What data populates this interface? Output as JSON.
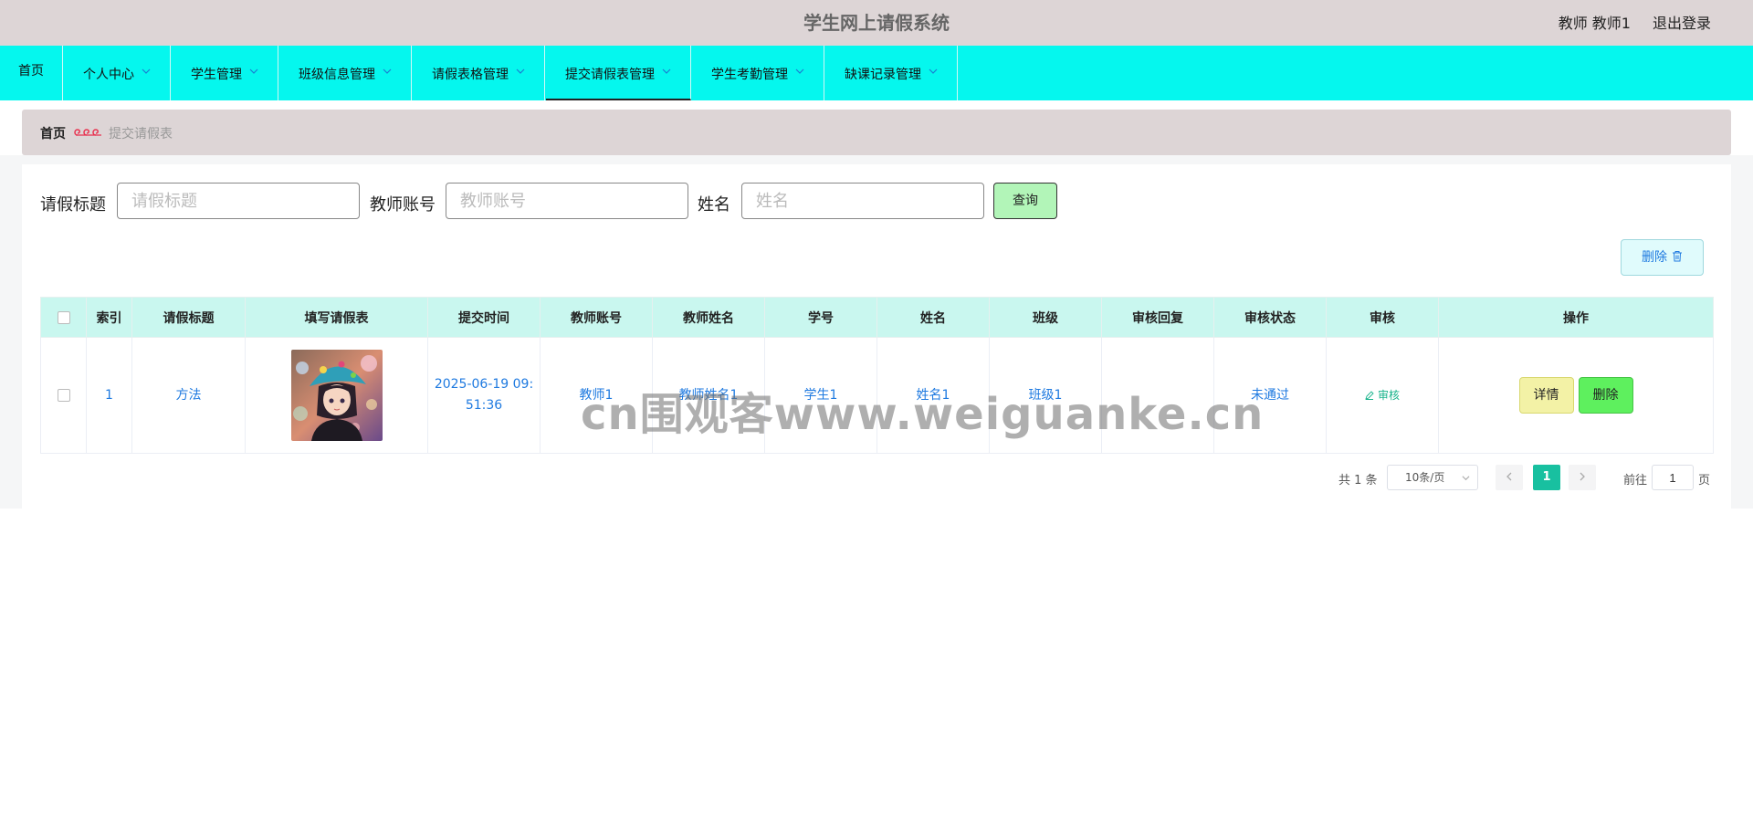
{
  "header": {
    "title": "学生网上请假系统",
    "user": "教师 教师1",
    "logout": "退出登录"
  },
  "nav": {
    "items": [
      {
        "label": "首页"
      },
      {
        "label": "个人中心"
      },
      {
        "label": "学生管理"
      },
      {
        "label": "班级信息管理"
      },
      {
        "label": "请假表格管理"
      },
      {
        "label": "提交请假表管理"
      },
      {
        "label": "学生考勤管理"
      },
      {
        "label": "缺课记录管理"
      }
    ],
    "active_index": 5
  },
  "breadcrumb": {
    "home": "首页",
    "current": "提交请假表"
  },
  "search": {
    "title_label": "请假标题",
    "title_placeholder": "请假标题",
    "teacher_label": "教师账号",
    "teacher_placeholder": "教师账号",
    "name_label": "姓名",
    "name_placeholder": "姓名",
    "query_button": "查询"
  },
  "toolbar": {
    "delete_label": "删除"
  },
  "table": {
    "headers": [
      "索引",
      "请假标题",
      "填写请假表",
      "提交时间",
      "教师账号",
      "教师姓名",
      "学号",
      "姓名",
      "班级",
      "审核回复",
      "审核状态",
      "审核",
      "操作"
    ],
    "rows": [
      {
        "index": "1",
        "title": "方法",
        "time_line1": "2025-06-19 09:",
        "time_line2": "51:36",
        "teacher_account": "教师1",
        "teacher_name": "教师姓名1",
        "student_no": "学生1",
        "name": "姓名1",
        "class": "班级1",
        "reply": "",
        "status": "未通过",
        "audit_label": "审核",
        "detail_label": "详情",
        "delete_label": "删除"
      }
    ]
  },
  "pagination": {
    "total": "共 1 条",
    "page_size": "10条/页",
    "current_page": "1",
    "goto_label": "前往",
    "goto_value": "1",
    "page_unit": "页"
  },
  "watermark": "cn围观客www.weiguanke.cn",
  "colors": {
    "topbar": "#ddd5d6",
    "nav": "#05f7ee",
    "table_header": "#c9f7ef",
    "query_button": "#b2f5b8",
    "detail_button": "#f3f2a6",
    "delete_button": "#5ef05e",
    "page_active": "#18c0a0",
    "link_text": "#1f7ae0"
  }
}
